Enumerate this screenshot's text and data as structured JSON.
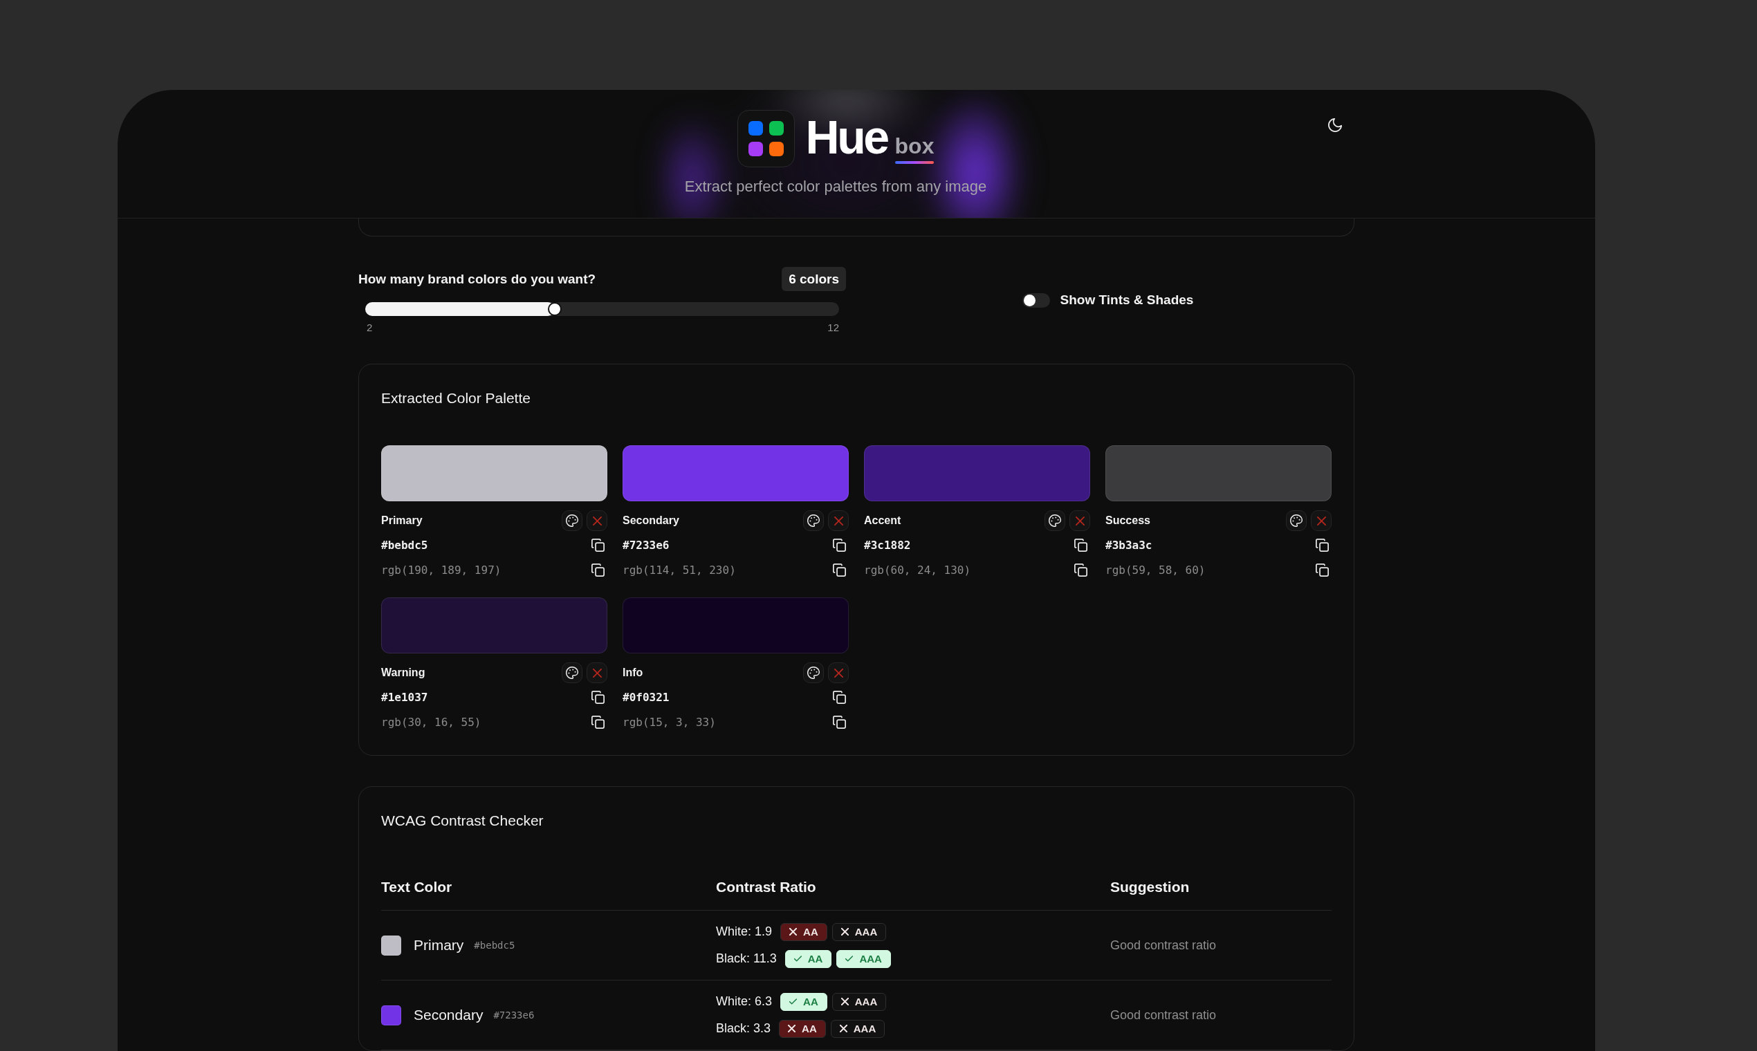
{
  "header": {
    "logo_title": "Hue",
    "logo_suffix": "box",
    "tagline": "Extract perfect color palettes from any image"
  },
  "controls": {
    "color_count": {
      "label": "How many brand colors do you want?",
      "value_badge": "6 colors",
      "level": 0.4,
      "min_label": "2",
      "max_label": "12"
    },
    "tints_toggle": {
      "label": "Show Tints & Shades",
      "on": false
    }
  },
  "palette": {
    "title": "Extracted Color Palette",
    "colors": [
      {
        "name": "Primary",
        "hex": "#bebdc5",
        "rgb": "rgb(190, 189, 197)",
        "color": "#bebdc5"
      },
      {
        "name": "Secondary",
        "hex": "#7233e6",
        "rgb": "rgb(114, 51, 230)",
        "color": "#7233e6"
      },
      {
        "name": "Accent",
        "hex": "#3c1882",
        "rgb": "rgb(60, 24, 130)",
        "color": "#3c1882"
      },
      {
        "name": "Success",
        "hex": "#3b3a3c",
        "rgb": "rgb(59, 58, 60)",
        "color": "#3b3a3c"
      },
      {
        "name": "Warning",
        "hex": "#1e1037",
        "rgb": "rgb(30, 16, 55)",
        "color": "#1e1037"
      },
      {
        "name": "Info",
        "hex": "#0f0321",
        "rgb": "rgb(15, 3, 33)",
        "color": "#0f0321"
      }
    ]
  },
  "contrast_checker": {
    "title": "WCAG Contrast Checker",
    "columns": [
      "Text Color",
      "Contrast Ratio",
      "Suggestion"
    ],
    "rows": [
      {
        "name": "Primary",
        "hex": "#bebdc5",
        "color": "#bebdc5",
        "results": [
          {
            "label": "White: 1.9",
            "badges": [
              {
                "text": "AA",
                "pass": false,
                "color": "#5b1717"
              },
              {
                "text": "AAA",
                "pass": false,
                "color": "#121212"
              }
            ]
          },
          {
            "label": "Black: 11.3",
            "badges": [
              {
                "text": "AA",
                "pass": true,
                "color": "#d3f8e2"
              },
              {
                "text": "AAA",
                "pass": true,
                "color": "#d3f8e2"
              }
            ]
          }
        ],
        "suggestion": "Good contrast ratio"
      },
      {
        "name": "Secondary",
        "hex": "#7233e6",
        "color": "#7233e6",
        "results": [
          {
            "label": "White: 6.3",
            "badges": [
              {
                "text": "AA",
                "pass": true,
                "color": "#d3f8e2"
              },
              {
                "text": "AAA",
                "pass": false,
                "color": "#121212"
              }
            ]
          },
          {
            "label": "Black: 3.3",
            "badges": [
              {
                "text": "AA",
                "pass": false,
                "color": "#5b1717"
              },
              {
                "text": "AAA",
                "pass": false,
                "color": "#121212"
              }
            ]
          }
        ],
        "suggestion": "Good contrast ratio"
      }
    ]
  }
}
